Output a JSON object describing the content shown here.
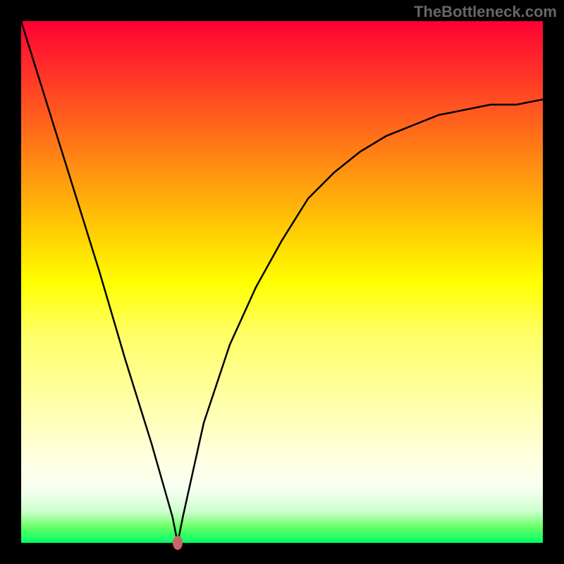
{
  "watermark": "TheBottleneck.com",
  "chart_data": {
    "type": "line",
    "title": "",
    "xlabel": "",
    "ylabel": "",
    "xlim": [
      0,
      1
    ],
    "ylim": [
      0,
      1
    ],
    "series": [
      {
        "name": "curve",
        "x": [
          0.0,
          0.05,
          0.1,
          0.15,
          0.2,
          0.25,
          0.27,
          0.29,
          0.3,
          0.31,
          0.33,
          0.35,
          0.4,
          0.45,
          0.5,
          0.55,
          0.6,
          0.65,
          0.7,
          0.75,
          0.8,
          0.85,
          0.9,
          0.95,
          1.0
        ],
        "y": [
          1.0,
          0.84,
          0.68,
          0.52,
          0.35,
          0.19,
          0.12,
          0.05,
          0.0,
          0.05,
          0.14,
          0.23,
          0.38,
          0.49,
          0.58,
          0.66,
          0.71,
          0.75,
          0.78,
          0.8,
          0.82,
          0.83,
          0.84,
          0.84,
          0.85
        ]
      }
    ],
    "marker": {
      "x": 0.3,
      "y": 0.0
    },
    "background_gradient": {
      "type": "vertical",
      "stops": [
        {
          "pos": 0.0,
          "color": "#ff0033"
        },
        {
          "pos": 0.5,
          "color": "#ffff00"
        },
        {
          "pos": 0.85,
          "color": "#ffffe6"
        },
        {
          "pos": 1.0,
          "color": "#00ff66"
        }
      ]
    }
  }
}
